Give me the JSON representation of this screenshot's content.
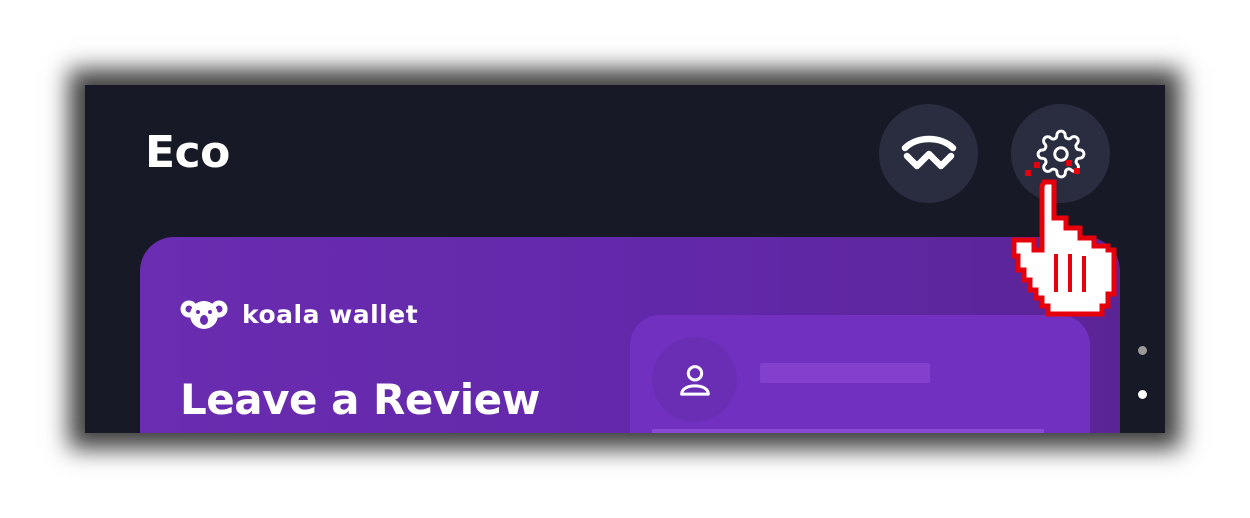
{
  "header": {
    "title": "Eco",
    "walletconnect_icon": "walletconnect-icon",
    "settings_icon": "gear-icon"
  },
  "promo_card": {
    "brand_icon": "koala-icon",
    "brand_name": "koala wallet",
    "heading": "Leave a Review",
    "avatar_icon": "user-icon"
  },
  "pager": {
    "total": 2,
    "active_index": 1
  },
  "overlay": {
    "pointer_icon": "hand-pointer-icon"
  },
  "colors": {
    "background": "#181926",
    "button_bg": "#2a2c40",
    "card_purple": "#6228aa",
    "card_inner": "#7230c0",
    "text": "#ffffff",
    "pointer_outline": "#e5000b"
  }
}
